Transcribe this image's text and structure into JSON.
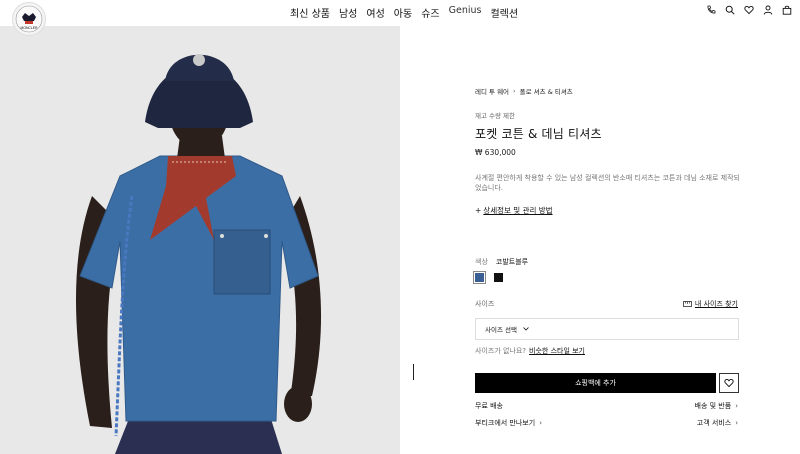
{
  "brand": {
    "logo_text": "MONCLER"
  },
  "nav": {
    "items": [
      "최신 상품",
      "남성",
      "여성",
      "아동",
      "슈즈",
      "Genius",
      "컬렉션"
    ]
  },
  "header_icons": [
    "phone-icon",
    "search-icon",
    "heart-icon",
    "user-icon",
    "bag-icon"
  ],
  "product": {
    "breadcrumb": [
      "레디 투 웨어",
      "폴로 셔츠 & 티셔츠"
    ],
    "stock_note": "재고 수량 제한",
    "title": "포켓 코튼 & 데님 티셔츠",
    "price": "₩ 630,000",
    "description": "사계절 편안하게 착용할 수 있는 남성 컬렉션의 반소매 티셔츠는 코튼과 데님 소재로 제작되었습니다.",
    "details_link": "상세정보 및 관리 방법",
    "color_label": "색상",
    "color_value": "코발트블루",
    "colors": [
      "#3a5f94",
      "#111111"
    ],
    "size_label": "사이즈",
    "size_guide": "내 사이즈 찾기",
    "size_select": "사이즈 선택",
    "size_question": "사이즈가 없나요?",
    "similar_link": "비슷한 스타일 보기",
    "add_to_bag": "쇼핑백에 추가",
    "free_shipping": "무료 배송",
    "shipping_returns": "배송 및 반품",
    "boutique": "부티크에서 만나보기",
    "customer_service": "고객 서비스"
  }
}
